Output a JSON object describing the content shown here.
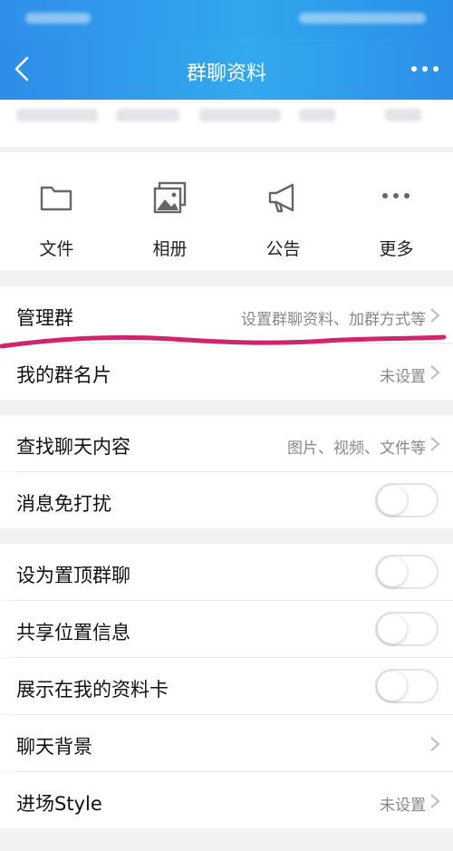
{
  "nav": {
    "title": "群聊资料"
  },
  "actions": [
    {
      "label": "文件",
      "icon": "folder-icon"
    },
    {
      "label": "相册",
      "icon": "photo-album-icon"
    },
    {
      "label": "公告",
      "icon": "megaphone-icon"
    },
    {
      "label": "更多",
      "icon": "more-icon"
    }
  ],
  "rows": {
    "manage_group": {
      "label": "管理群",
      "value": "设置群聊资料、加群方式等"
    },
    "my_card": {
      "label": "我的群名片",
      "value": "未设置"
    },
    "search_history": {
      "label": "查找聊天内容",
      "value": "图片、视频、文件等"
    },
    "mute": {
      "label": "消息免打扰",
      "toggle": false
    },
    "pin_top": {
      "label": "设为置顶群聊",
      "toggle": false
    },
    "share_location": {
      "label": "共享位置信息",
      "toggle": false
    },
    "show_on_card": {
      "label": "展示在我的资料卡",
      "toggle": false
    },
    "chat_background": {
      "label": "聊天背景"
    },
    "entry_style": {
      "label": "进场Style",
      "value": "未设置"
    }
  },
  "colors": {
    "accent": "#2f9aec",
    "annotation": "#d0246c"
  }
}
